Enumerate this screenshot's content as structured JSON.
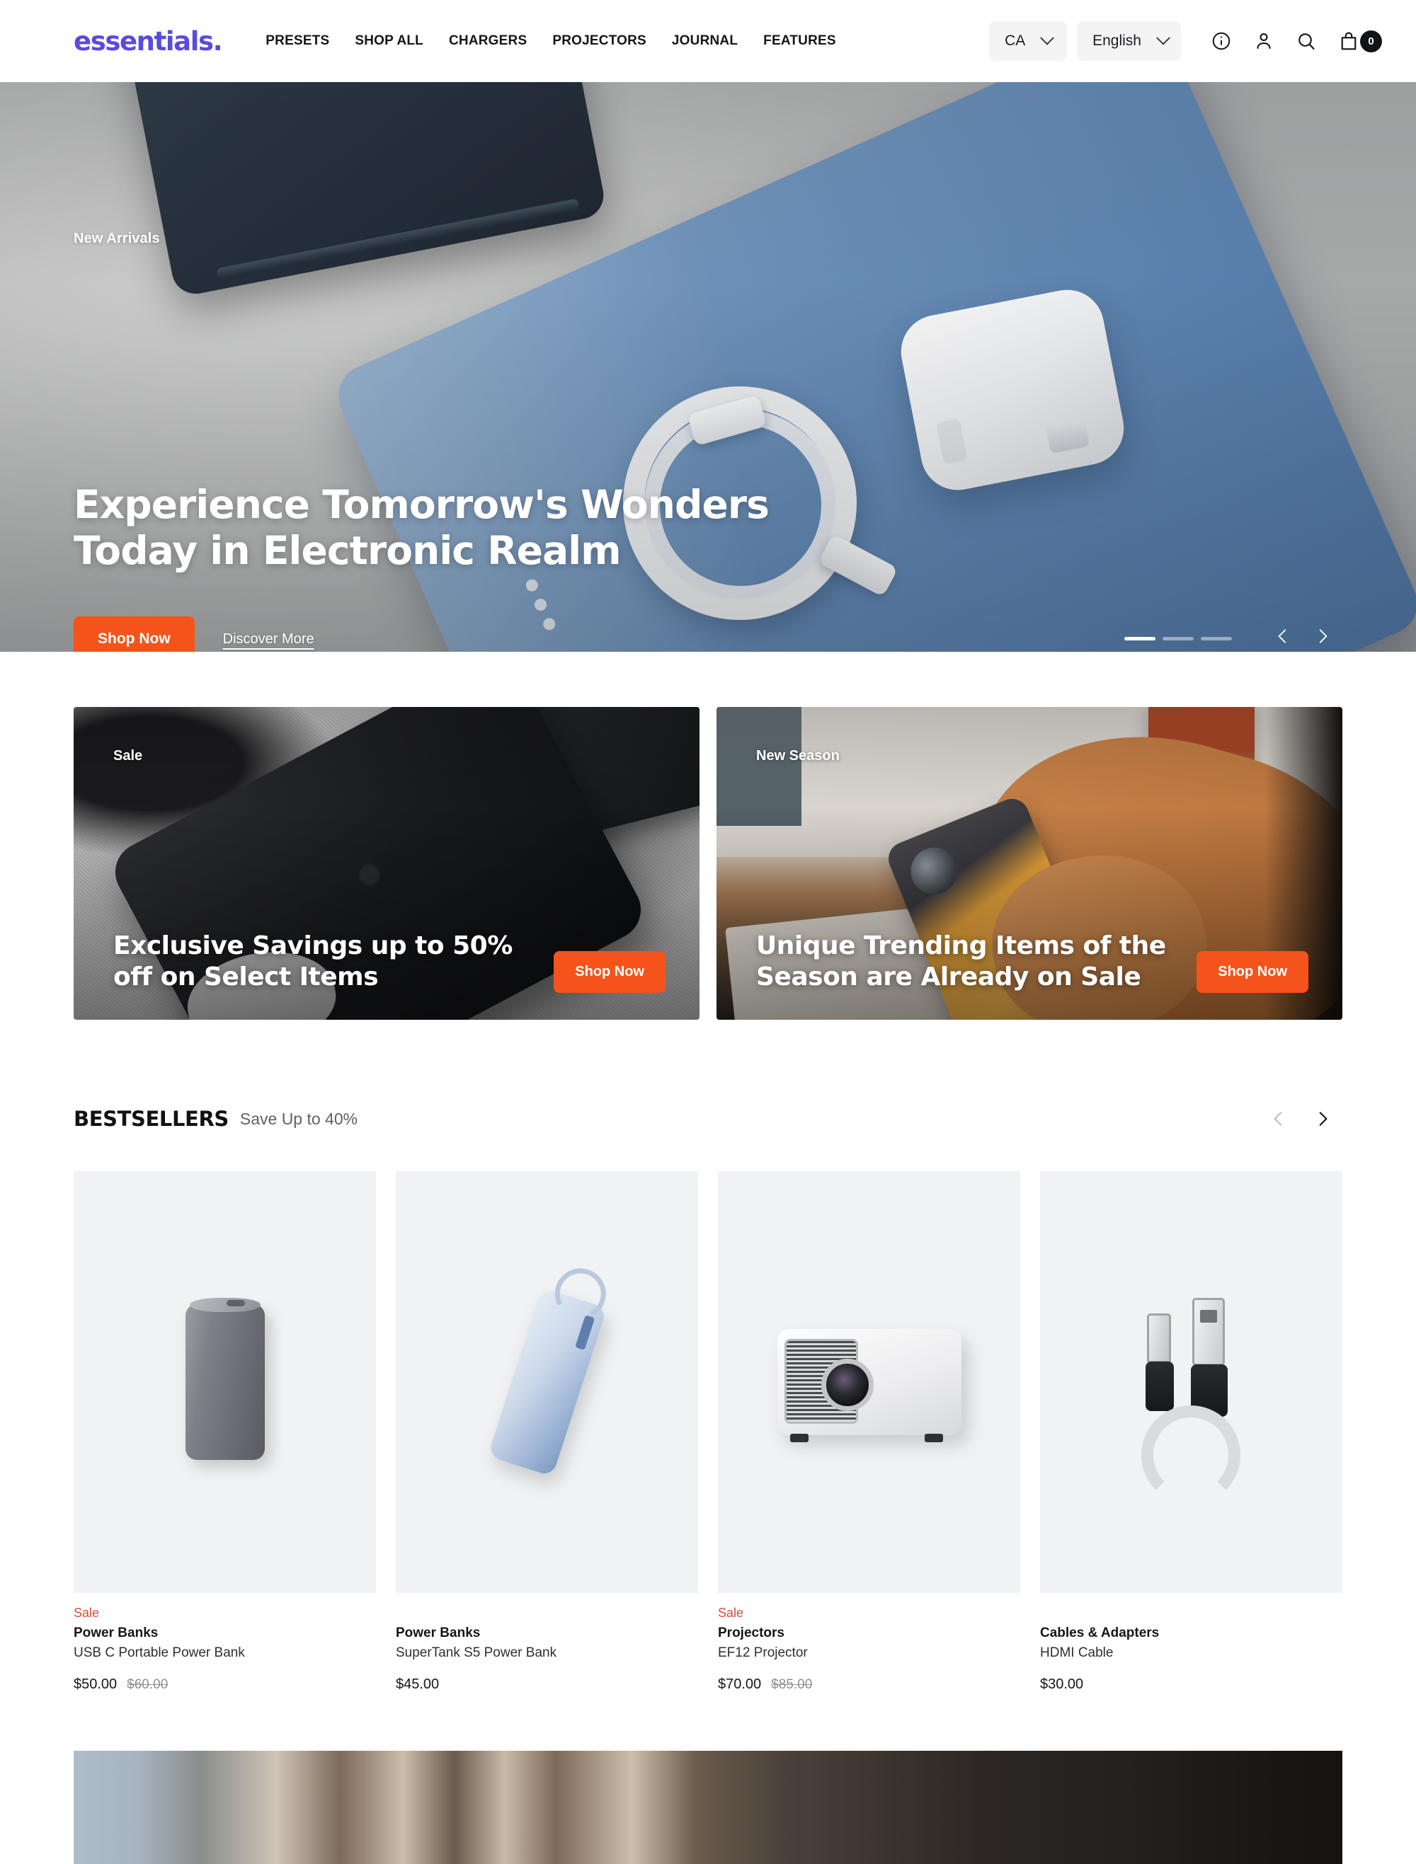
{
  "header": {
    "logo": "essentials.",
    "nav": [
      {
        "label": "PRESETS"
      },
      {
        "label": "SHOP ALL"
      },
      {
        "label": "CHARGERS"
      },
      {
        "label": "PROJECTORS"
      },
      {
        "label": "JOURNAL"
      },
      {
        "label": "FEATURES"
      }
    ],
    "country_select": {
      "value": "CA",
      "icon": "chevron-down-icon"
    },
    "language_select": {
      "value": "English",
      "icon": "chevron-down-icon"
    },
    "icons": [
      {
        "name": "info-icon"
      },
      {
        "name": "account-icon"
      },
      {
        "name": "search-icon"
      },
      {
        "name": "cart-icon"
      }
    ],
    "cart_count": "0"
  },
  "hero": {
    "eyebrow": "New Arrivals",
    "title": "Experience Tomorrow's Wonders Today in Electronic Realm",
    "primary_cta": "Shop Now",
    "secondary_cta": "Discover More",
    "slides_total": 3,
    "active_slide": 1,
    "prev_icon": "chevron-left-icon",
    "next_icon": "chevron-right-icon"
  },
  "promos": [
    {
      "tag": "Sale",
      "title": "Exclusive Savings up to 50% off on Select Items",
      "cta": "Shop Now"
    },
    {
      "tag": "New Season",
      "title": "Unique Trending Items of the Season are Already on Sale",
      "cta": "Shop Now"
    }
  ],
  "bestsellers": {
    "title": "BESTSELLERS",
    "subtitle": "Save Up to 40%",
    "prev_icon": "chevron-left-icon",
    "next_icon": "chevron-right-icon",
    "products": [
      {
        "badge": "Sale",
        "category": "Power Banks",
        "name": "USB C Portable Power Bank",
        "price": "$50.00",
        "compare_at": "$60.00"
      },
      {
        "badge": "",
        "category": "Power Banks",
        "name": "SuperTank S5 Power Bank",
        "price": "$45.00",
        "compare_at": ""
      },
      {
        "badge": "Sale",
        "category": "Projectors",
        "name": "EF12 Projector",
        "price": "$70.00",
        "compare_at": "$85.00"
      },
      {
        "badge": "",
        "category": "Cables & Adapters",
        "name": "HDMI Cable",
        "price": "$30.00",
        "compare_at": ""
      }
    ]
  },
  "colors": {
    "brand_purple": "#5b4ae0",
    "accent_orange": "#f4541b",
    "sale_red": "#d94b3a",
    "text_dark": "#15161a",
    "card_bg": "#f1f2f4"
  }
}
